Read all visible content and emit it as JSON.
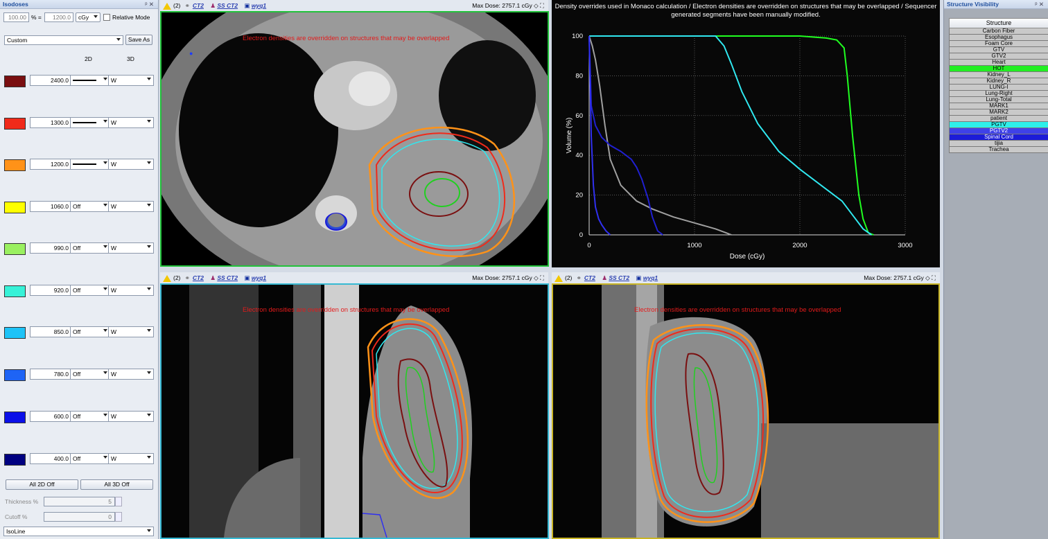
{
  "isodoses": {
    "panel_title": "Isodoses",
    "pin_label": "ᵖ ✕",
    "percent_value": "100.00",
    "percent_unit": "% =",
    "dose_value": "1200.0",
    "dose_unit": "cGy",
    "relative_mode_label": "Relative Mode",
    "preset": "Custom",
    "save_as": "Save As",
    "col_2d": "2D",
    "col_3d": "3D",
    "levels": [
      {
        "value": "2400.0",
        "color": "#7a0f10",
        "style2d": "line",
        "style3d": "W"
      },
      {
        "value": "1300.0",
        "color": "#f02a1a",
        "style2d": "line",
        "style3d": "W"
      },
      {
        "value": "1200.0",
        "color": "#ff9218",
        "style2d": "line",
        "style3d": "W"
      },
      {
        "value": "1060.0",
        "color": "#ffff00",
        "style2d": "Off",
        "style3d": "W"
      },
      {
        "value": "990.0",
        "color": "#9af060",
        "style2d": "Off",
        "style3d": "W"
      },
      {
        "value": "920.0",
        "color": "#37f2d8",
        "style2d": "Off",
        "style3d": "W"
      },
      {
        "value": "850.0",
        "color": "#1ec3f7",
        "style2d": "Off",
        "style3d": "W"
      },
      {
        "value": "780.0",
        "color": "#1e64f5",
        "style2d": "Off",
        "style3d": "W"
      },
      {
        "value": "600.0",
        "color": "#0b10e8",
        "style2d": "Off",
        "style3d": "W"
      },
      {
        "value": "400.0",
        "color": "#000080",
        "style2d": "Off",
        "style3d": "W"
      }
    ],
    "all_2d_off": "All 2D Off",
    "all_3d_off": "All 3D Off",
    "thickness_label": "Thickness %",
    "thickness_value": "5",
    "cutoff_label": "Cutoff %",
    "cutoff_value": "0",
    "display_mode": "IsoLine"
  },
  "viewport_toolbar": {
    "count": "(2)",
    "ct": "CT2",
    "ss": "SS CT2",
    "plan": "wyq1",
    "max_dose": "Max Dose: 2757.1 cGy"
  },
  "overlay_message": "Electron densities are overridden on structures that may be overlapped",
  "dvh": {
    "note": "Density overrides used in Monaco calculation / Electron densities are overridden on structures that may be overlapped / Sequencer generated segments have been manually modified.",
    "xlabel": "Dose (cGy)",
    "ylabel": "Volume (%)",
    "x_ticks": [
      "0",
      "1000",
      "2000",
      "3000"
    ],
    "y_ticks": [
      "0",
      "20",
      "40",
      "60",
      "80",
      "100"
    ]
  },
  "chart_data": {
    "type": "line",
    "title": "",
    "xlabel": "Dose (cGy)",
    "ylabel": "Volume (%)",
    "xlim": [
      0,
      3000
    ],
    "ylim": [
      0,
      100
    ],
    "grid": true,
    "series": [
      {
        "color": "#20ff20",
        "x": [
          0,
          2000,
          2250,
          2350,
          2420,
          2450,
          2500,
          2560,
          2600,
          2650,
          2700
        ],
        "y": [
          100,
          100,
          99,
          98,
          94,
          80,
          50,
          20,
          8,
          1,
          0
        ]
      },
      {
        "color": "#30e8f0",
        "x": [
          0,
          1200,
          1280,
          1350,
          1450,
          1600,
          1800,
          2000,
          2200,
          2400,
          2500,
          2600,
          2680
        ],
        "y": [
          100,
          100,
          95,
          86,
          72,
          56,
          42,
          33,
          25,
          17,
          10,
          3,
          0
        ]
      },
      {
        "color": "#a0a0a0",
        "x": [
          0,
          30,
          60,
          100,
          150,
          200,
          300,
          450,
          600,
          800,
          1000,
          1200,
          1300,
          1350
        ],
        "y": [
          100,
          95,
          88,
          75,
          55,
          38,
          25,
          17,
          13,
          9,
          6,
          3,
          1,
          0
        ]
      },
      {
        "color": "#2020d0",
        "x": [
          0,
          20,
          60,
          120,
          200,
          300,
          400,
          450,
          500,
          560,
          600,
          650,
          700
        ],
        "y": [
          100,
          65,
          55,
          49,
          45,
          42,
          38,
          34,
          28,
          18,
          9,
          2,
          0
        ]
      },
      {
        "color": "#3030f0",
        "x": [
          0,
          8,
          20,
          40,
          60,
          90,
          120,
          160,
          200
        ],
        "y": [
          100,
          80,
          50,
          25,
          14,
          8,
          5,
          2,
          0
        ]
      }
    ]
  },
  "structures": {
    "panel_title": "Structure Visibility",
    "pin_label": "ᵖ ✕",
    "header": "Structure",
    "items": [
      {
        "name": "Carbon Fiber",
        "color": "#c9c9c9"
      },
      {
        "name": "Esophagus",
        "color": "#c9c9c9"
      },
      {
        "name": "Foam Core",
        "color": "#c9c9c9"
      },
      {
        "name": "GTV",
        "color": "#c9c9c9"
      },
      {
        "name": "GTV2",
        "color": "#c9c9c9"
      },
      {
        "name": "Heart",
        "color": "#c9c9c9"
      },
      {
        "name": "HOT",
        "color": "#22ee22"
      },
      {
        "name": "Kidney_L",
        "color": "#c9c9c9"
      },
      {
        "name": "Kidney_R",
        "color": "#c9c9c9"
      },
      {
        "name": "LUNG-l",
        "color": "#c9c9c9"
      },
      {
        "name": "Lung-Right",
        "color": "#c9c9c9"
      },
      {
        "name": "Lung-Total",
        "color": "#c9c9c9"
      },
      {
        "name": "MARK1",
        "color": "#c9c9c9"
      },
      {
        "name": "MARK2",
        "color": "#c9c9c9"
      },
      {
        "name": "patient",
        "color": "#c9c9c9"
      },
      {
        "name": "PGTV",
        "color": "#2ef0ea"
      },
      {
        "name": "PGTV2",
        "color": "#3f41e8"
      },
      {
        "name": "Spinal Cord",
        "color": "#1c1cd8"
      },
      {
        "name": "tijia",
        "color": "#c9c9c9"
      },
      {
        "name": "Trachea",
        "color": "#c9c9c9"
      }
    ]
  }
}
